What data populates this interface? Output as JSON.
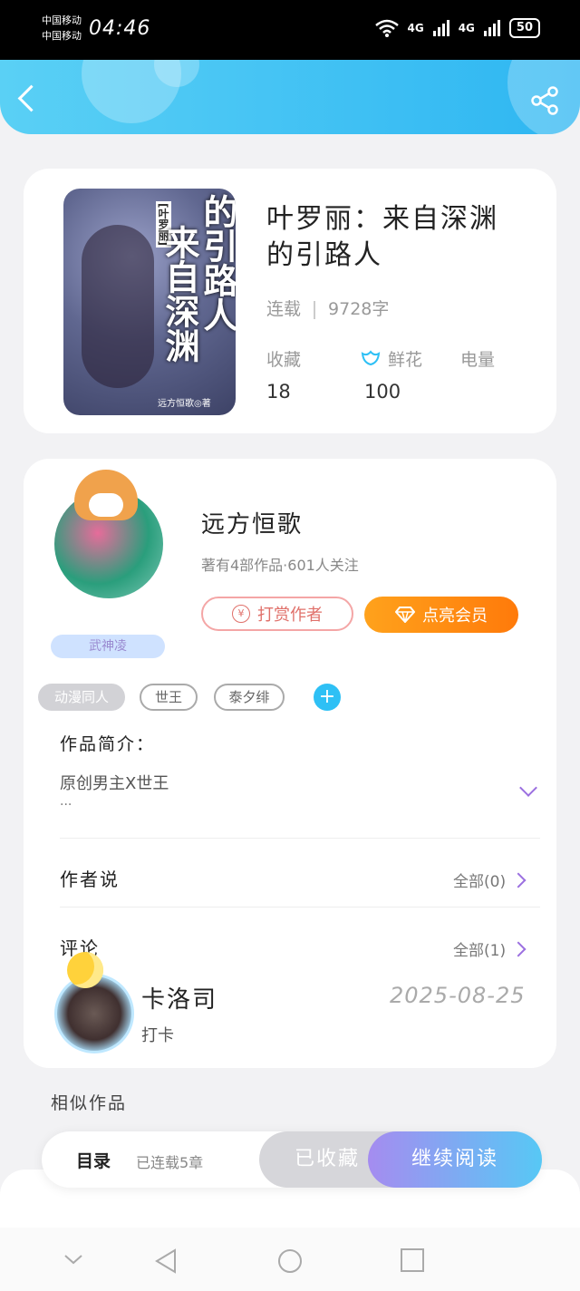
{
  "status_bar": {
    "carrier_1": "中国移动",
    "carrier_2": "中国移动",
    "time": "04:46",
    "network_1": "4G",
    "network_2": "4G",
    "battery": "50"
  },
  "header": {
    "back_icon": "chevron-left-icon",
    "share_icon": "share-icon"
  },
  "book": {
    "cover_bracket_title": "[叶罗丽]",
    "cover_line1": "的引路人",
    "cover_line2": "来自深渊",
    "cover_author": "远方恒歌◎著",
    "title": "叶罗丽：来自深渊的引路人",
    "status": "连载",
    "word_count": "9728字",
    "stats": {
      "favorites_label": "收藏",
      "favorites_value": "18",
      "flowers_label": "鲜花",
      "flowers_value": "100",
      "power_label": "电量"
    }
  },
  "author": {
    "name": "远方恒歌",
    "info": "著有4部作品·601人关注",
    "badge": "武神凌",
    "reward_button": "打赏作者",
    "reward_coin": "¥",
    "vip_button": "点亮会员"
  },
  "tags": [
    "动漫同人",
    "世王",
    "泰夕绯"
  ],
  "intro": {
    "label": "作品简介：",
    "text": "原创男主X世王",
    "ellipsis": "..."
  },
  "author_says": {
    "label": "作者说",
    "link": "全部(0)"
  },
  "comments": {
    "label": "评论",
    "link": "全部(1)",
    "items": [
      {
        "user": "卡洛司",
        "date": "2025-08-25",
        "text": "打卡"
      }
    ]
  },
  "similar": {
    "label": "相似作品"
  },
  "bottom_bar": {
    "toc": "目录",
    "chapters": "已连载5章",
    "faved": "已收藏",
    "read": "继续阅读"
  },
  "colors": {
    "header_gradient_start": "#5ad0f5",
    "header_gradient_end": "#2eb6f2",
    "vip_orange": "#ff8a10",
    "read_gradient_start": "#a58cf0",
    "read_gradient_end": "#57c8f5",
    "accent_purple": "#9b6fe0"
  }
}
